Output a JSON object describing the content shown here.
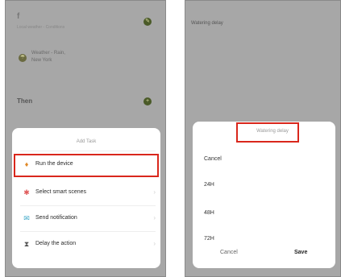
{
  "left": {
    "background": {
      "heading_letter": "f",
      "subtitle": "Local weather - Conditions",
      "location_line1": "Weather - Rain,",
      "location_line2": "New York",
      "then_label": "Then"
    },
    "sheet": {
      "title": "Add Task",
      "options": [
        {
          "label": "Run the device",
          "icon": "device-icon"
        },
        {
          "label": "Select smart scenes",
          "icon": "scene-icon"
        },
        {
          "label": "Send notification",
          "icon": "bell-icon"
        },
        {
          "label": "Delay the action",
          "icon": "hourglass-icon"
        }
      ]
    }
  },
  "right": {
    "header_title": "Watering delay",
    "sheet": {
      "title": "Watering delay",
      "options": [
        "Cancel",
        "24H",
        "48H",
        "72H"
      ],
      "cancel_label": "Cancel",
      "save_label": "Save"
    }
  },
  "highlight_color": "#d9271c"
}
